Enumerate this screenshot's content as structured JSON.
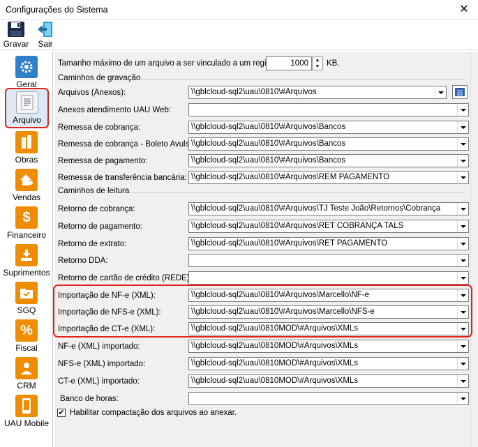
{
  "window": {
    "title": "Configurações do Sistema",
    "close": "✕"
  },
  "toolbar": {
    "save_label": "Gravar",
    "exit_label": "Sair"
  },
  "sidebar": {
    "items": [
      {
        "label": "Geral"
      },
      {
        "label": "Arquivo"
      },
      {
        "label": "Obras"
      },
      {
        "label": "Vendas"
      },
      {
        "label": "Financeiro"
      },
      {
        "label": "Suprimentos"
      },
      {
        "label": "SGQ"
      },
      {
        "label": "Fiscal"
      },
      {
        "label": "CRM"
      },
      {
        "label": "UAU Mobile"
      }
    ]
  },
  "form": {
    "max_size_label": "Tamanho máximo de um arquivo a ser vinculado a um registro:",
    "max_size_value": "1000",
    "max_size_unit": "KB.",
    "group_gravacao": "Caminhos de gravação",
    "group_leitura": "Caminhos de leitura",
    "rows_gravacao": [
      {
        "label": "Arquivos (Anexos):",
        "value": "\\\\gblcloud-sql2\\uau\\0810\\#Arquivos"
      },
      {
        "label": "Anexos atendimento UAU Web:",
        "value": ""
      },
      {
        "label": "Remessa de cobrança:",
        "value": "\\\\gblcloud-sql2\\uau\\0810\\#Arquivos\\Bancos"
      },
      {
        "label": "Remessa de cobrança - Boleto Avulso:",
        "value": "\\\\gblcloud-sql2\\uau\\0810\\#Arquivos\\Bancos"
      },
      {
        "label": "Remessa de pagamento:",
        "value": "\\\\gblcloud-sql2\\uau\\0810\\#Arquivos\\Bancos"
      },
      {
        "label": "Remessa de transferência bancária:",
        "value": "\\\\gblcloud-sql2\\uau\\0810\\#Arquivos\\REM PAGAMENTO"
      }
    ],
    "rows_leitura": [
      {
        "label": "Retorno de cobrança:",
        "value": "\\\\gblcloud-sql2\\uau\\0810\\#Arquivos\\TJ Teste João\\Retornos\\Cobrança"
      },
      {
        "label": "Retorno de pagamento:",
        "value": "\\\\gblcloud-sql2\\uau\\0810\\#Arquivos\\RET COBRANÇA TALS"
      },
      {
        "label": "Retorno de extrato:",
        "value": "\\\\gblcloud-sql2\\uau\\0810\\#Arquivos\\RET PAGAMENTO"
      },
      {
        "label": "Retorno DDA:",
        "value": ""
      },
      {
        "label": "Retorno de cartão de crédito (REDE):",
        "value": ""
      },
      {
        "label": "Importação de NF-e (XML):",
        "value": "\\\\gblcloud-sql2\\uau\\0810\\#Arquivos\\Marcello\\NF-e"
      },
      {
        "label": "Importação de NFS-e (XML):",
        "value": "\\\\gblcloud-sql2\\uau\\0810\\#Arquivos\\Marcello\\NFS-e"
      },
      {
        "label": "Importação de CT-e (XML):",
        "value": "\\\\gblcloud-sql2\\uau\\0810MOD\\#Arquivos\\XMLs"
      },
      {
        "label": "NF-e (XML) importado:",
        "value": "\\\\gblcloud-sql2\\uau\\0810MOD\\#Arquivos\\XMLs"
      },
      {
        "label": "NFS-e (XML) importado:",
        "value": "\\\\gblcloud-sql2\\uau\\0810MOD\\#Arquivos\\XMLs"
      },
      {
        "label": "CT-e (XML) importado:",
        "value": "\\\\gblcloud-sql2\\uau\\0810MOD\\#Arquivos\\XMLs"
      },
      {
        "label": "Banco de horas:",
        "value": ""
      }
    ],
    "compress_label": "Habilitar compactação dos arquivos ao anexar.",
    "compress_checked": "✔"
  }
}
